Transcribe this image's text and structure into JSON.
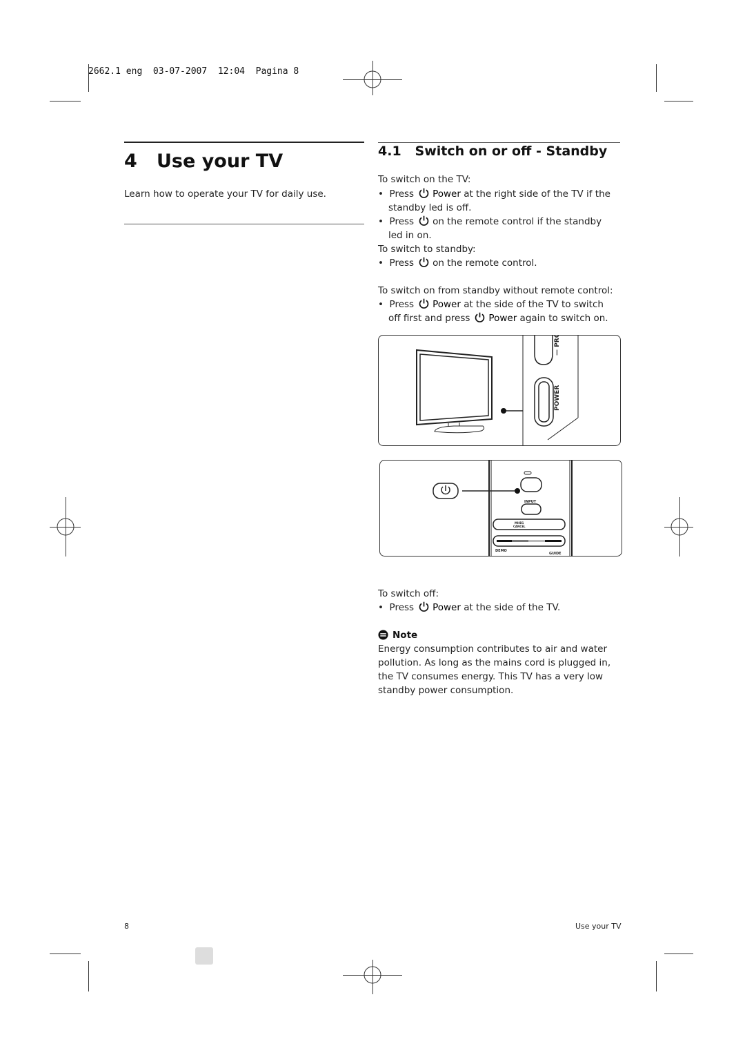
{
  "print_header": "2662.1 eng  03-07-2007  12:04  Pagina 8",
  "chapter": {
    "number": "4",
    "title": "Use your TV",
    "intro": "Learn how to operate your TV for daily use."
  },
  "section": {
    "number": "4.1",
    "title": "Switch on or off - Standby"
  },
  "body": {
    "switch_on_heading": "To switch on the TV:",
    "b1_pre": "Press",
    "b1_bold": "Power",
    "b1_post": "at the right side of the TV if the",
    "b1_cont": "standby led is off.",
    "b2_pre": "Press",
    "b2_post": "on the remote control if the standby",
    "b2_cont": "led in on.",
    "standby_heading": "To switch to standby:",
    "b3_pre": "Press",
    "b3_post": "on the remote control.",
    "no_remote_heading": "To switch on from standby without remote control:",
    "b4_pre": "Press",
    "b4_bold": "Power",
    "b4_post": "at the side of the TV to switch",
    "b4_cont_pre": "off first and press",
    "b4_cont_bold": "Power",
    "b4_cont_post": "again to switch on.",
    "switch_off_heading": "To switch off:",
    "b5_pre": "Press",
    "b5_bold": "Power",
    "b5_post": "at the side of the TV."
  },
  "figure_tv": {
    "label_pro": "— PRO",
    "label_power": "POWER"
  },
  "figure_remote": {
    "label_input": "INPUT",
    "label_mheg1": "MHEG",
    "label_mheg2": "CANCEL",
    "label_demo": "DEMO",
    "label_guide": "GUIDE"
  },
  "note": {
    "title": "Note",
    "icon": "note-icon",
    "text": [
      "Energy consumption contributes to air and water",
      "pollution. As long as the mains cord is plugged in,",
      "the TV consumes energy. This TV has a very low",
      "standby power consumption."
    ]
  },
  "footer": {
    "page_number": "8",
    "running_title": "Use your TV"
  },
  "icons": {
    "power": "power-icon",
    "bullet": "•"
  }
}
